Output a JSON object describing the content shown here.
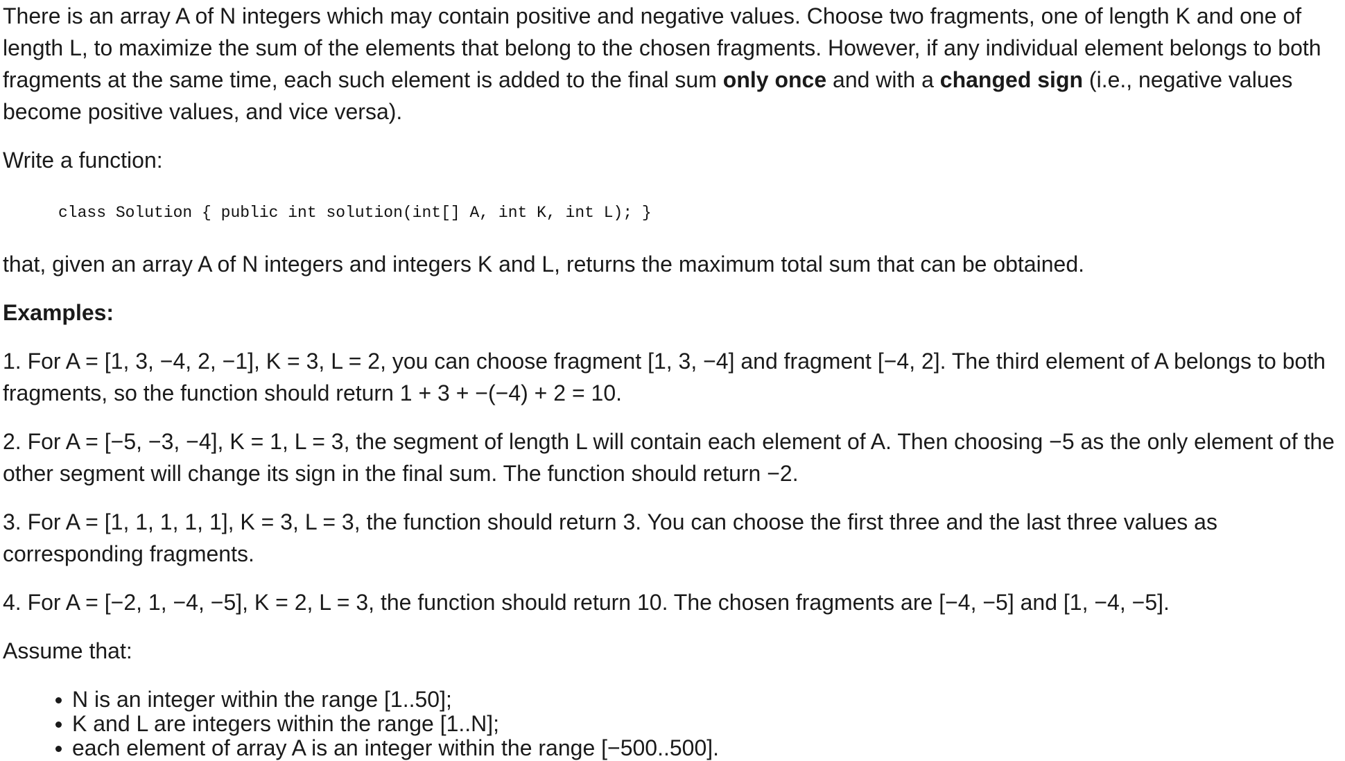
{
  "intro": {
    "part1": "There is an array A of N integers which may contain positive and negative values. Choose two fragments, one of length K and one of length L, to maximize the sum of the elements that belong to the chosen fragments. However, if any individual element belongs to both fragments at the same time, each such element is added to the final sum ",
    "bold1": "only once",
    "part2": " and with a ",
    "bold2": "changed sign",
    "part3": " (i.e., negative values become positive values, and vice versa)."
  },
  "write_function": "Write a function:",
  "code_signature": "class Solution { public int solution(int[] A, int K, int L); }",
  "function_description": "that, given an array A of N integers and integers K and L, returns the maximum total sum that can be obtained.",
  "examples_heading": "Examples:",
  "examples": [
    "1. For A = [1, 3, −4, 2, −1], K = 3, L = 2, you can choose fragment [1, 3, −4] and fragment [−4, 2]. The third element of A belongs to both fragments, so the function should return 1 + 3 + −(−4) + 2 = 10.",
    "2. For A = [−5, −3, −4], K = 1, L = 3, the segment of length L will contain each element of A. Then choosing −5 as the only element of the other segment will change its sign in the final sum. The function should return −2.",
    "3. For A = [1, 1, 1, 1, 1], K = 3, L = 3, the function should return 3. You can choose the first three and the last three values as corresponding fragments.",
    "4. For A = [−2, 1, −4, −5], K = 2, L = 3, the function should return 10. The chosen fragments are [−4, −5] and [1, −4, −5]."
  ],
  "assume_heading": "Assume that:",
  "constraints": [
    "N is an integer within the range [1..50];",
    "K and L are integers within the range [1..N];",
    "each element of array A is an integer within the range [−500..500]."
  ]
}
